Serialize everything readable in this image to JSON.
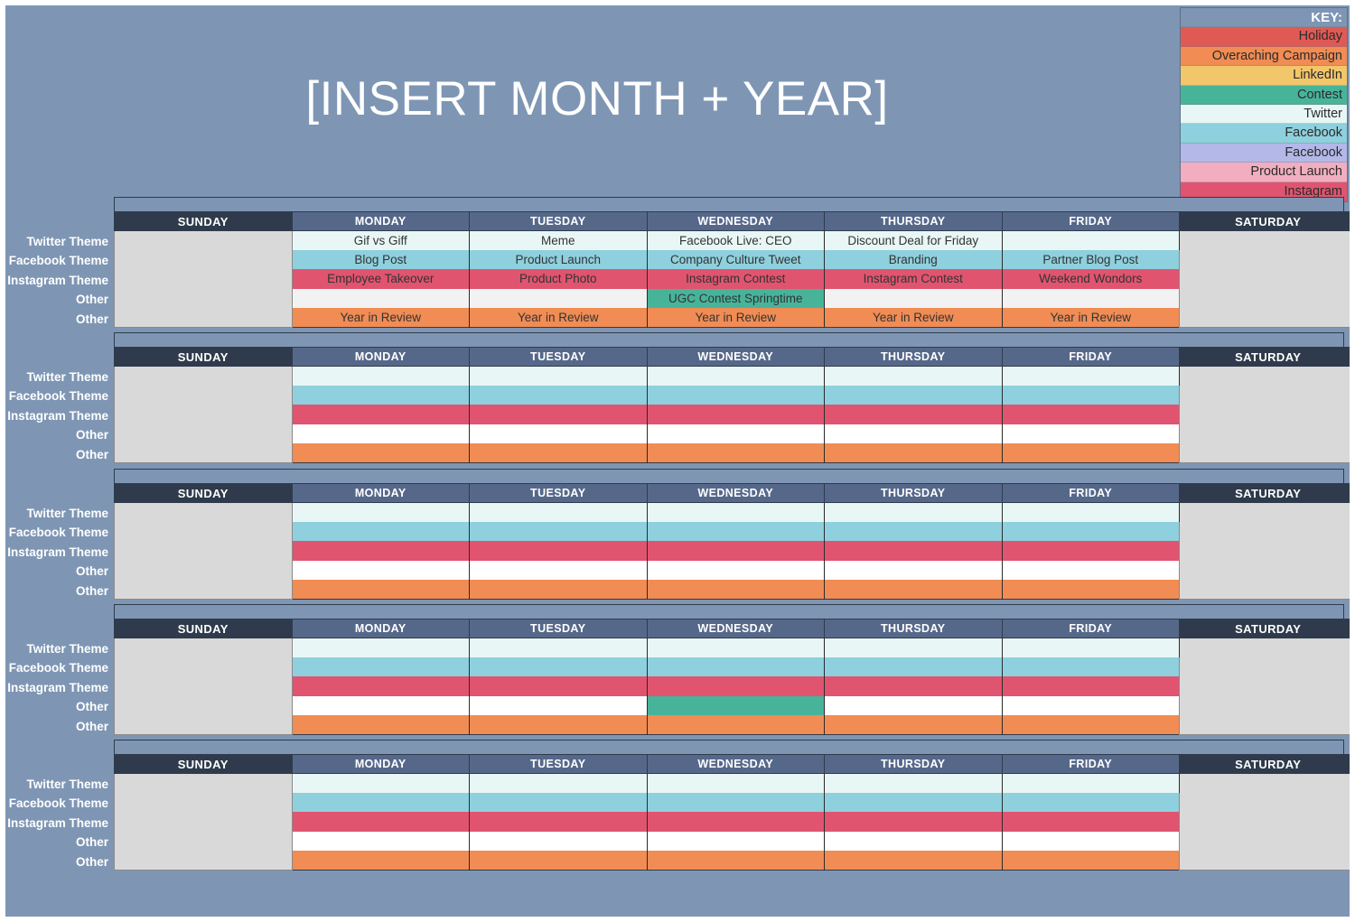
{
  "title": "[INSERT MONTH + YEAR]",
  "key": {
    "heading": "KEY:",
    "items": [
      {
        "label": "Holiday",
        "color": "#e05a55"
      },
      {
        "label": "Overaching Campaign",
        "color": "#f08c54"
      },
      {
        "label": "LinkedIn",
        "color": "#f2c66a"
      },
      {
        "label": "Contest",
        "color": "#47b49a"
      },
      {
        "label": "Twitter",
        "color": "#e8f7f5"
      },
      {
        "label": "Facebook",
        "color": "#8ed0dd"
      },
      {
        "label": "Facebook",
        "color": "#b3b8e8"
      },
      {
        "label": "Product Launch",
        "color": "#f2aec0"
      },
      {
        "label": "Instagram",
        "color": "#e0546f"
      }
    ]
  },
  "day_headers": [
    "SUNDAY",
    "MONDAY",
    "TUESDAY",
    "WEDNESDAY",
    "THURSDAY",
    "FRIDAY",
    "SATURDAY"
  ],
  "row_labels": [
    "Twitter Theme",
    "Facebook Theme",
    "Instagram Theme",
    "Other",
    "Other"
  ],
  "weeks": [
    {
      "name": "week-1",
      "rows": [
        {
          "theme": "twitter",
          "cells": [
            "",
            "Gif vs Giff",
            "Meme",
            "Facebook Live: CEO",
            "Discount Deal for Friday",
            "",
            ""
          ]
        },
        {
          "theme": "facebook",
          "cells": [
            "",
            "Blog Post",
            "Product Launch",
            "Company Culture Tweet",
            "Branding",
            "Partner Blog Post",
            ""
          ]
        },
        {
          "theme": "instagram",
          "cells": [
            "",
            "Employee Takeover",
            "Product Photo",
            "Instagram Contest",
            "Instagram Contest",
            "Weekend Wondors",
            ""
          ]
        },
        {
          "theme": "other1",
          "cells": [
            "",
            "",
            "",
            "UGC Contest Springtime",
            "",
            "",
            ""
          ],
          "overrides": {
            "3": "contest"
          }
        },
        {
          "theme": "other2",
          "cells": [
            "",
            "Year in Review",
            "Year in Review",
            "Year in Review",
            "Year in Review",
            "Year in Review",
            ""
          ]
        }
      ]
    },
    {
      "name": "week-2",
      "rows": [
        {
          "theme": "twitter",
          "cells": [
            "",
            "",
            "",
            "",
            "",
            "",
            ""
          ]
        },
        {
          "theme": "facebook",
          "cells": [
            "",
            "",
            "",
            "",
            "",
            "",
            ""
          ]
        },
        {
          "theme": "instagram",
          "cells": [
            "",
            "",
            "",
            "",
            "",
            "",
            ""
          ]
        },
        {
          "theme": "other1-blank",
          "cells": [
            "",
            "",
            "",
            "",
            "",
            "",
            ""
          ]
        },
        {
          "theme": "other2",
          "cells": [
            "",
            "",
            "",
            "",
            "",
            "",
            ""
          ]
        }
      ]
    },
    {
      "name": "week-3",
      "rows": [
        {
          "theme": "twitter",
          "cells": [
            "",
            "",
            "",
            "",
            "",
            "",
            ""
          ]
        },
        {
          "theme": "facebook",
          "cells": [
            "",
            "",
            "",
            "",
            "",
            "",
            ""
          ]
        },
        {
          "theme": "instagram",
          "cells": [
            "",
            "",
            "",
            "",
            "",
            "",
            ""
          ]
        },
        {
          "theme": "other1-blank",
          "cells": [
            "",
            "",
            "",
            "",
            "",
            "",
            ""
          ]
        },
        {
          "theme": "other2",
          "cells": [
            "",
            "",
            "",
            "",
            "",
            "",
            ""
          ]
        }
      ]
    },
    {
      "name": "week-4",
      "rows": [
        {
          "theme": "twitter",
          "cells": [
            "",
            "",
            "",
            "",
            "",
            "",
            ""
          ]
        },
        {
          "theme": "facebook",
          "cells": [
            "",
            "",
            "",
            "",
            "",
            "",
            ""
          ]
        },
        {
          "theme": "instagram",
          "cells": [
            "",
            "",
            "",
            "",
            "",
            "",
            ""
          ]
        },
        {
          "theme": "other1-blank",
          "cells": [
            "",
            "",
            "",
            "",
            "",
            "",
            ""
          ],
          "overrides": {
            "3": "contest"
          }
        },
        {
          "theme": "other2",
          "cells": [
            "",
            "",
            "",
            "",
            "",
            "",
            ""
          ]
        }
      ]
    },
    {
      "name": "week-5",
      "rows": [
        {
          "theme": "twitter",
          "cells": [
            "",
            "",
            "",
            "",
            "",
            "",
            ""
          ]
        },
        {
          "theme": "facebook",
          "cells": [
            "",
            "",
            "",
            "",
            "",
            "",
            ""
          ]
        },
        {
          "theme": "instagram",
          "cells": [
            "",
            "",
            "",
            "",
            "",
            "",
            ""
          ]
        },
        {
          "theme": "other1-blank",
          "cells": [
            "",
            "",
            "",
            "",
            "",
            "",
            ""
          ]
        },
        {
          "theme": "other2",
          "cells": [
            "",
            "",
            "",
            "",
            "",
            "",
            ""
          ]
        }
      ]
    }
  ]
}
